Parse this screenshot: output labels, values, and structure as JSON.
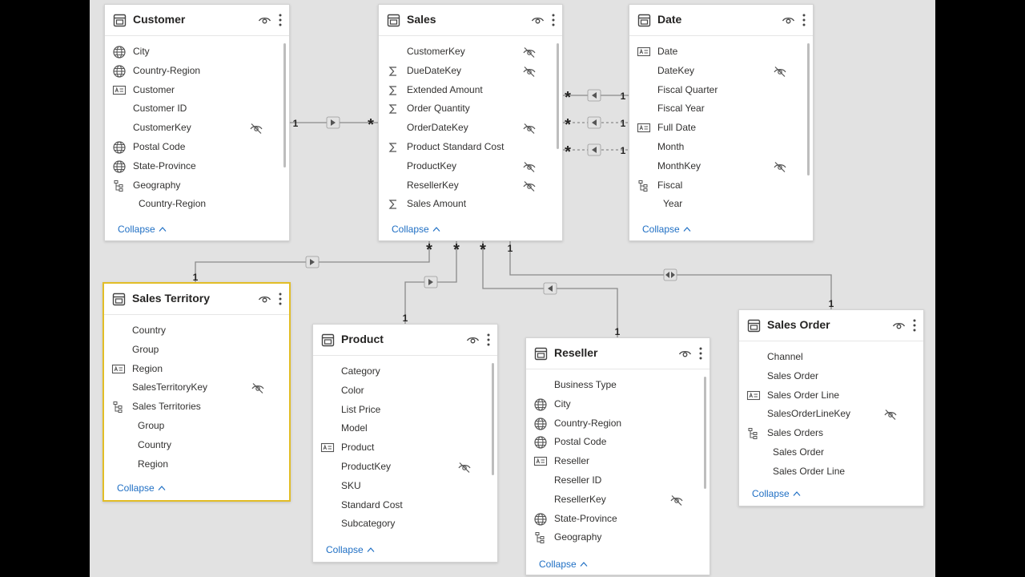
{
  "collapse_label": "Collapse",
  "cards": {
    "customer": {
      "title": "Customer",
      "fields": [
        {
          "label": "City",
          "icon": "globe"
        },
        {
          "label": "Country-Region",
          "icon": "globe"
        },
        {
          "label": "Customer",
          "icon": "text"
        },
        {
          "label": "Customer ID",
          "icon": ""
        },
        {
          "label": "CustomerKey",
          "icon": "",
          "hidden": true
        },
        {
          "label": "Postal Code",
          "icon": "globe"
        },
        {
          "label": "State-Province",
          "icon": "globe"
        },
        {
          "label": "Geography",
          "icon": "hierarchy"
        },
        {
          "label": "Country-Region",
          "icon": "",
          "child": true
        }
      ]
    },
    "sales": {
      "title": "Sales",
      "fields": [
        {
          "label": "CustomerKey",
          "icon": "",
          "hidden": true
        },
        {
          "label": "DueDateKey",
          "icon": "sigma",
          "hidden": true
        },
        {
          "label": "Extended Amount",
          "icon": "sigma"
        },
        {
          "label": "Order Quantity",
          "icon": "sigma"
        },
        {
          "label": "OrderDateKey",
          "icon": "",
          "hidden": true
        },
        {
          "label": "Product Standard Cost",
          "icon": "sigma"
        },
        {
          "label": "ProductKey",
          "icon": "",
          "hidden": true
        },
        {
          "label": "ResellerKey",
          "icon": "",
          "hidden": true
        },
        {
          "label": "Sales Amount",
          "icon": "sigma"
        }
      ]
    },
    "date": {
      "title": "Date",
      "fields": [
        {
          "label": "Date",
          "icon": "text"
        },
        {
          "label": "DateKey",
          "icon": "",
          "hidden": true
        },
        {
          "label": "Fiscal Quarter",
          "icon": ""
        },
        {
          "label": "Fiscal Year",
          "icon": ""
        },
        {
          "label": "Full Date",
          "icon": "text"
        },
        {
          "label": "Month",
          "icon": ""
        },
        {
          "label": "MonthKey",
          "icon": "",
          "hidden": true
        },
        {
          "label": "Fiscal",
          "icon": "hierarchy"
        },
        {
          "label": "Year",
          "icon": "",
          "child": true
        }
      ]
    },
    "sales_territory": {
      "title": "Sales Territory",
      "fields": [
        {
          "label": "Country",
          "icon": ""
        },
        {
          "label": "Group",
          "icon": ""
        },
        {
          "label": "Region",
          "icon": "text"
        },
        {
          "label": "SalesTerritoryKey",
          "icon": "",
          "hidden": true
        },
        {
          "label": "Sales Territories",
          "icon": "hierarchy"
        },
        {
          "label": "Group",
          "icon": "",
          "child": true
        },
        {
          "label": "Country",
          "icon": "",
          "child": true
        },
        {
          "label": "Region",
          "icon": "",
          "child": true
        }
      ]
    },
    "product": {
      "title": "Product",
      "fields": [
        {
          "label": "Category",
          "icon": ""
        },
        {
          "label": "Color",
          "icon": ""
        },
        {
          "label": "List Price",
          "icon": ""
        },
        {
          "label": "Model",
          "icon": ""
        },
        {
          "label": "Product",
          "icon": "text"
        },
        {
          "label": "ProductKey",
          "icon": "",
          "hidden": true
        },
        {
          "label": "SKU",
          "icon": ""
        },
        {
          "label": "Standard Cost",
          "icon": ""
        },
        {
          "label": "Subcategory",
          "icon": ""
        }
      ]
    },
    "reseller": {
      "title": "Reseller",
      "fields": [
        {
          "label": "Business Type",
          "icon": ""
        },
        {
          "label": "City",
          "icon": "globe"
        },
        {
          "label": "Country-Region",
          "icon": "globe"
        },
        {
          "label": "Postal Code",
          "icon": "globe"
        },
        {
          "label": "Reseller",
          "icon": "text"
        },
        {
          "label": "Reseller ID",
          "icon": ""
        },
        {
          "label": "ResellerKey",
          "icon": "",
          "hidden": true
        },
        {
          "label": "State-Province",
          "icon": "globe"
        },
        {
          "label": "Geography",
          "icon": "hierarchy"
        }
      ]
    },
    "sales_order": {
      "title": "Sales Order",
      "fields": [
        {
          "label": "Channel",
          "icon": ""
        },
        {
          "label": "Sales Order",
          "icon": ""
        },
        {
          "label": "Sales Order Line",
          "icon": "text"
        },
        {
          "label": "SalesOrderLineKey",
          "icon": "",
          "hidden": true
        },
        {
          "label": "Sales Orders",
          "icon": "hierarchy"
        },
        {
          "label": "Sales Order",
          "icon": "",
          "child": true
        },
        {
          "label": "Sales Order Line",
          "icon": "",
          "child": true
        }
      ]
    }
  },
  "relationships": [
    {
      "from": "Customer",
      "to": "Sales",
      "one": "1",
      "many": "*",
      "active": true
    },
    {
      "from": "Date",
      "to": "Sales",
      "one": "1",
      "many": "*",
      "active": true
    },
    {
      "from": "Date",
      "to": "Sales",
      "one": "1",
      "many": "*",
      "active": false
    },
    {
      "from": "Date",
      "to": "Sales",
      "one": "1",
      "many": "*",
      "active": false
    },
    {
      "from": "Sales Territory",
      "to": "Sales",
      "one": "1",
      "many": "*",
      "active": true
    },
    {
      "from": "Product",
      "to": "Sales",
      "one": "1",
      "many": "*",
      "active": true
    },
    {
      "from": "Reseller",
      "to": "Sales",
      "one": "1",
      "many": "*",
      "active": true
    },
    {
      "from": "Sales Order",
      "to": "Sales",
      "one": "1",
      "many": "1",
      "active": true
    }
  ]
}
